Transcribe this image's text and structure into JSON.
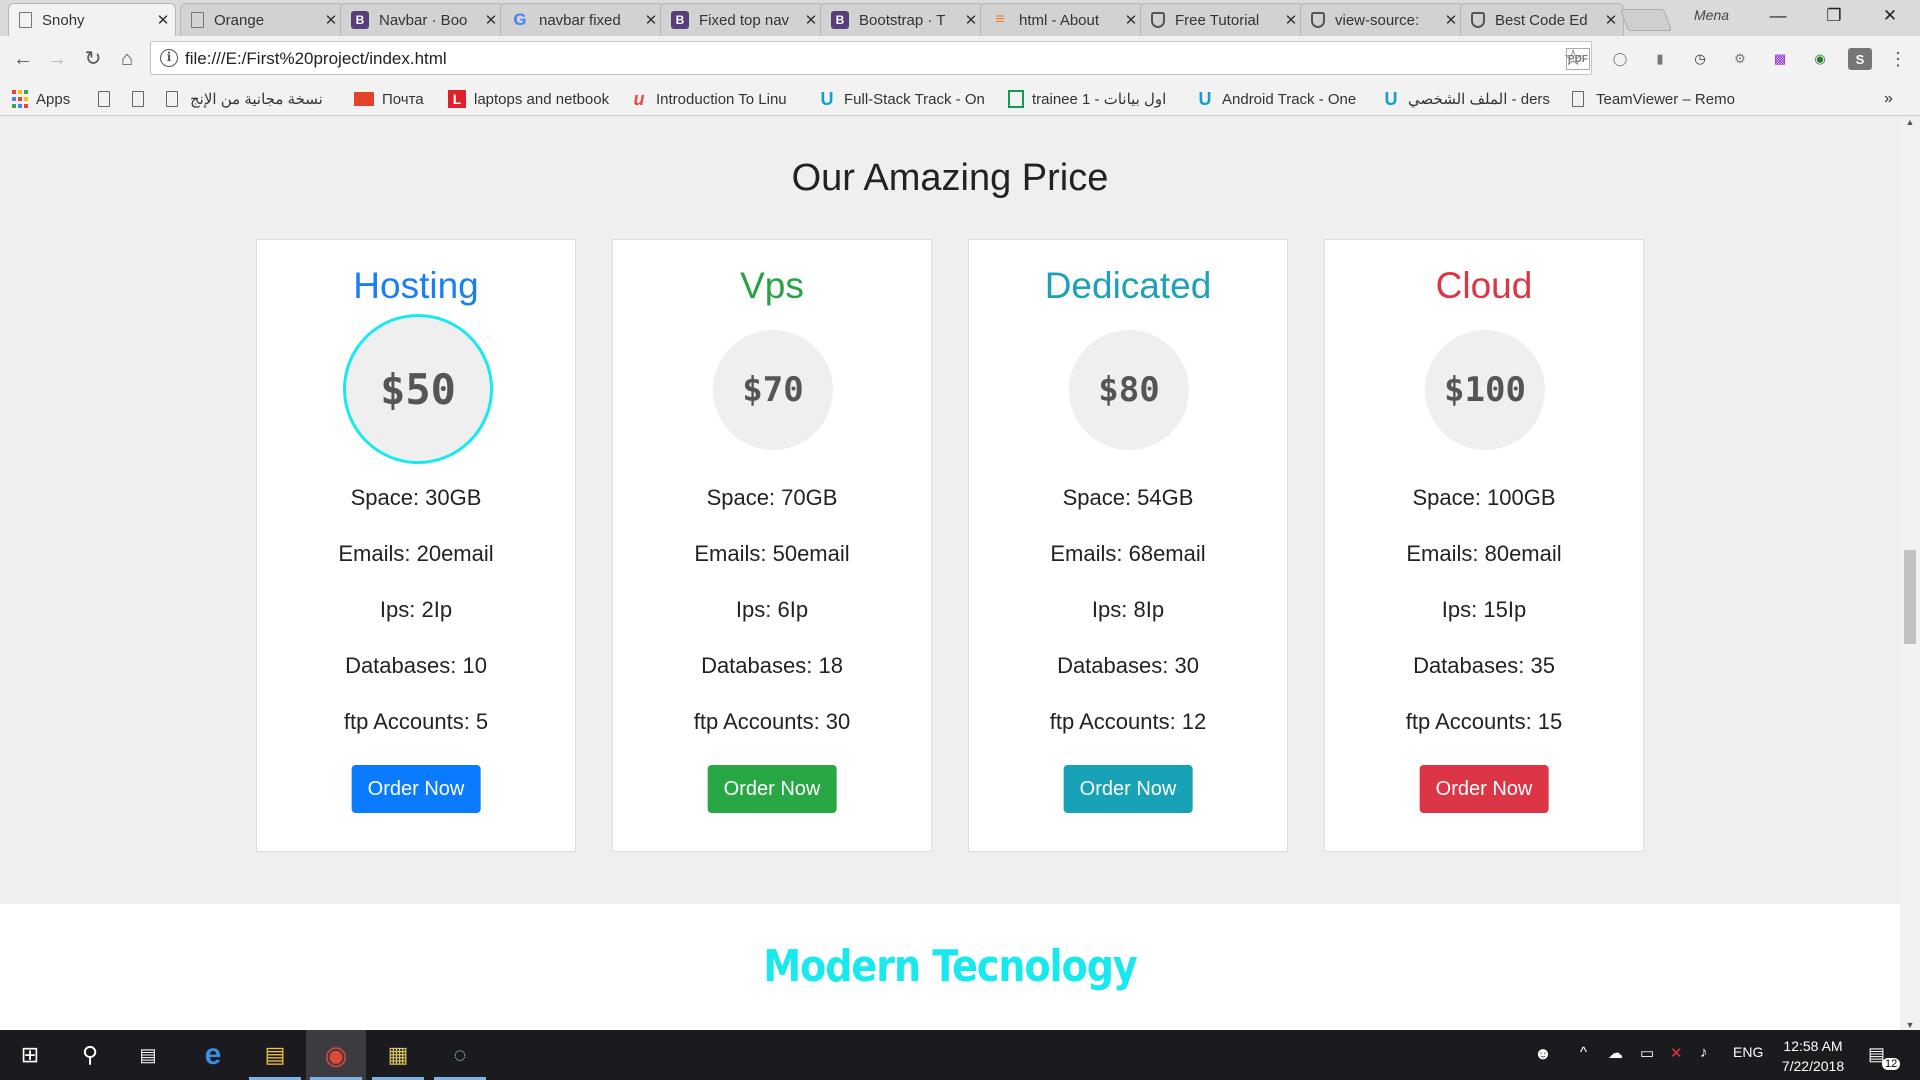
{
  "browser": {
    "tabs": [
      {
        "title": "Snohy",
        "favicon": "page-icon"
      },
      {
        "title": "Orange",
        "favicon": "page-icon"
      },
      {
        "title": "Navbar · Boo",
        "favicon": "bootstrap-icon"
      },
      {
        "title": "navbar fixed",
        "favicon": "google-icon"
      },
      {
        "title": "Fixed top nav",
        "favicon": "bootstrap-icon"
      },
      {
        "title": "Bootstrap · T",
        "favicon": "bootstrap-icon"
      },
      {
        "title": "html - About",
        "favicon": "stackoverflow-icon"
      },
      {
        "title": "Free Tutorial",
        "favicon": "shield-icon"
      },
      {
        "title": "view-source:",
        "favicon": "shield-icon"
      },
      {
        "title": "Best Code Ed",
        "favicon": "shield-icon"
      }
    ],
    "profile_name": "Mena",
    "url": "file:///E:/First%20project/index.html",
    "bookmarks": [
      {
        "label": "Apps"
      },
      {
        "label": ""
      },
      {
        "label": ""
      },
      {
        "label": "نسخة مجانية من الإنج"
      },
      {
        "label": "Почта"
      },
      {
        "label": "laptops and netbook"
      },
      {
        "label": "Introduction To Linu"
      },
      {
        "label": "Full-Stack Track - On"
      },
      {
        "label": "trainee 1 - اول بيانات"
      },
      {
        "label": "Android Track - One"
      },
      {
        "label": "الملف الشخصي - ders"
      },
      {
        "label": "TeamViewer – Remo"
      }
    ],
    "overflow_label": "»"
  },
  "page": {
    "pricing_title": "Our Amazing Price",
    "plans": [
      {
        "name": "Hosting",
        "price": "$50",
        "color": "#1a7ff0",
        "button_color": "#0a7bff",
        "features": [
          "Space: 30GB",
          "Emails: 20email",
          "Ips: 2Ip",
          "Databases: 10",
          "ftp Accounts: 5"
        ],
        "button": "Order Now"
      },
      {
        "name": "Vps",
        "price": "$70",
        "color": "#27a244",
        "button_color": "#28a745",
        "features": [
          "Space: 70GB",
          "Emails: 50email",
          "Ips: 6Ip",
          "Databases: 18",
          "ftp Accounts: 30"
        ],
        "button": "Order Now"
      },
      {
        "name": "Dedicated",
        "price": "$80",
        "color": "#1ca1b8",
        "button_color": "#17a2b8",
        "features": [
          "Space: 54GB",
          "Emails: 68email",
          "Ips: 8Ip",
          "Databases: 30",
          "ftp Accounts: 12"
        ],
        "button": "Order Now"
      },
      {
        "name": "Cloud",
        "price": "$100",
        "color": "#dc3545",
        "button_color": "#dc3545",
        "features": [
          "Space: 100GB",
          "Emails: 80email",
          "Ips: 15Ip",
          "Databases: 35",
          "ftp Accounts: 15"
        ],
        "button": "Order Now"
      }
    ],
    "modern_title": "Modern Tecnology"
  },
  "taskbar": {
    "language": "ENG",
    "time": "12:58 AM",
    "date": "7/22/2018",
    "notification_count": "12"
  }
}
